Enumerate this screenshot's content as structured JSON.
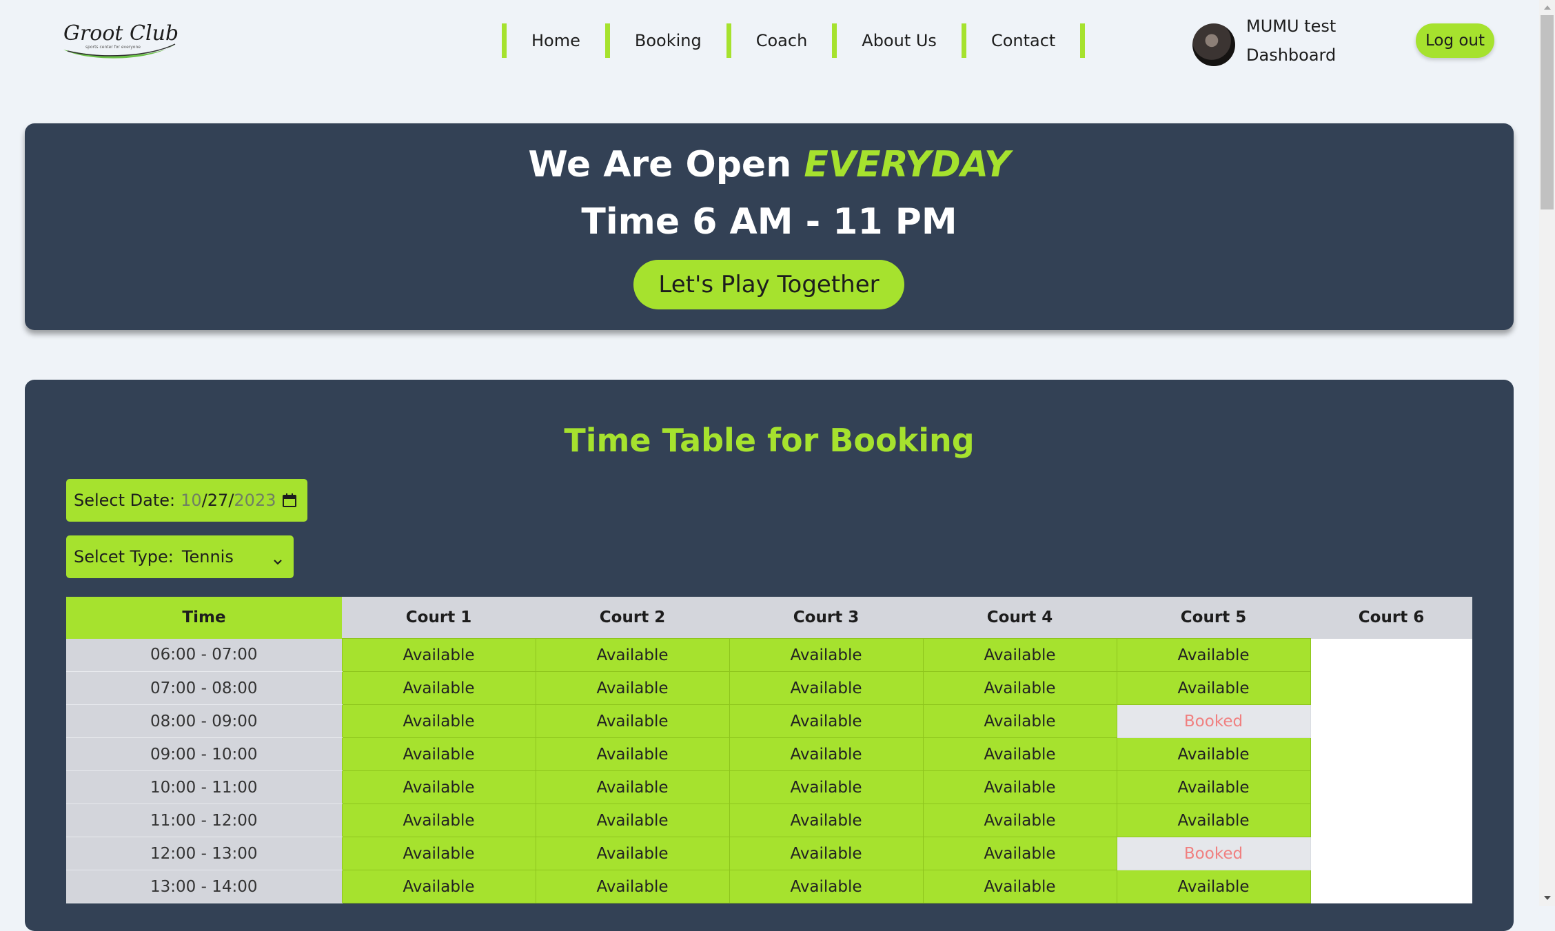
{
  "header": {
    "logo_text": "Groot Club",
    "logo_tagline": "sports center for everyone",
    "nav": [
      "Home",
      "Booking",
      "Coach",
      "About Us",
      "Contact"
    ],
    "user_name": "MUMU test",
    "dashboard_label": "Dashboard",
    "logout_label": "Log out"
  },
  "hero": {
    "line1_prefix": "We Are Open",
    "line1_accent": "EVERYDAY",
    "line2": "Time 6 AM - 11 PM",
    "button": "Let's Play Together"
  },
  "booking": {
    "title": "Time Table for Booking",
    "date_label": "Select Date:",
    "date_month": "10",
    "date_day": "27",
    "date_year": "2023",
    "type_label": "Selcet Type:",
    "type_value": "Tennis",
    "columns": [
      "Time",
      "Court 1",
      "Court 2",
      "Court 3",
      "Court 4",
      "Court 5",
      "Court 6"
    ],
    "rows": [
      {
        "time": "06:00 - 07:00",
        "cells": [
          "Available",
          "Available",
          "Available",
          "Available",
          "Available",
          ""
        ]
      },
      {
        "time": "07:00 - 08:00",
        "cells": [
          "Available",
          "Available",
          "Available",
          "Available",
          "Available",
          ""
        ]
      },
      {
        "time": "08:00 - 09:00",
        "cells": [
          "Available",
          "Available",
          "Available",
          "Available",
          "Booked",
          ""
        ]
      },
      {
        "time": "09:00 - 10:00",
        "cells": [
          "Available",
          "Available",
          "Available",
          "Available",
          "Available",
          ""
        ]
      },
      {
        "time": "10:00 - 11:00",
        "cells": [
          "Available",
          "Available",
          "Available",
          "Available",
          "Available",
          ""
        ]
      },
      {
        "time": "11:00 - 12:00",
        "cells": [
          "Available",
          "Available",
          "Available",
          "Available",
          "Available",
          ""
        ]
      },
      {
        "time": "12:00 - 13:00",
        "cells": [
          "Available",
          "Available",
          "Available",
          "Available",
          "Booked",
          ""
        ]
      },
      {
        "time": "13:00 - 14:00",
        "cells": [
          "Available",
          "Available",
          "Available",
          "Available",
          "Available",
          ""
        ]
      }
    ]
  },
  "colors": {
    "accent": "#a6e22e",
    "panel": "#334155",
    "page_bg": "#eff3f8",
    "booked_text": "#f08080"
  },
  "icons": {
    "calendar": "calendar-icon",
    "dropdown": "chevron-down-icon",
    "avatar": "avatar"
  }
}
